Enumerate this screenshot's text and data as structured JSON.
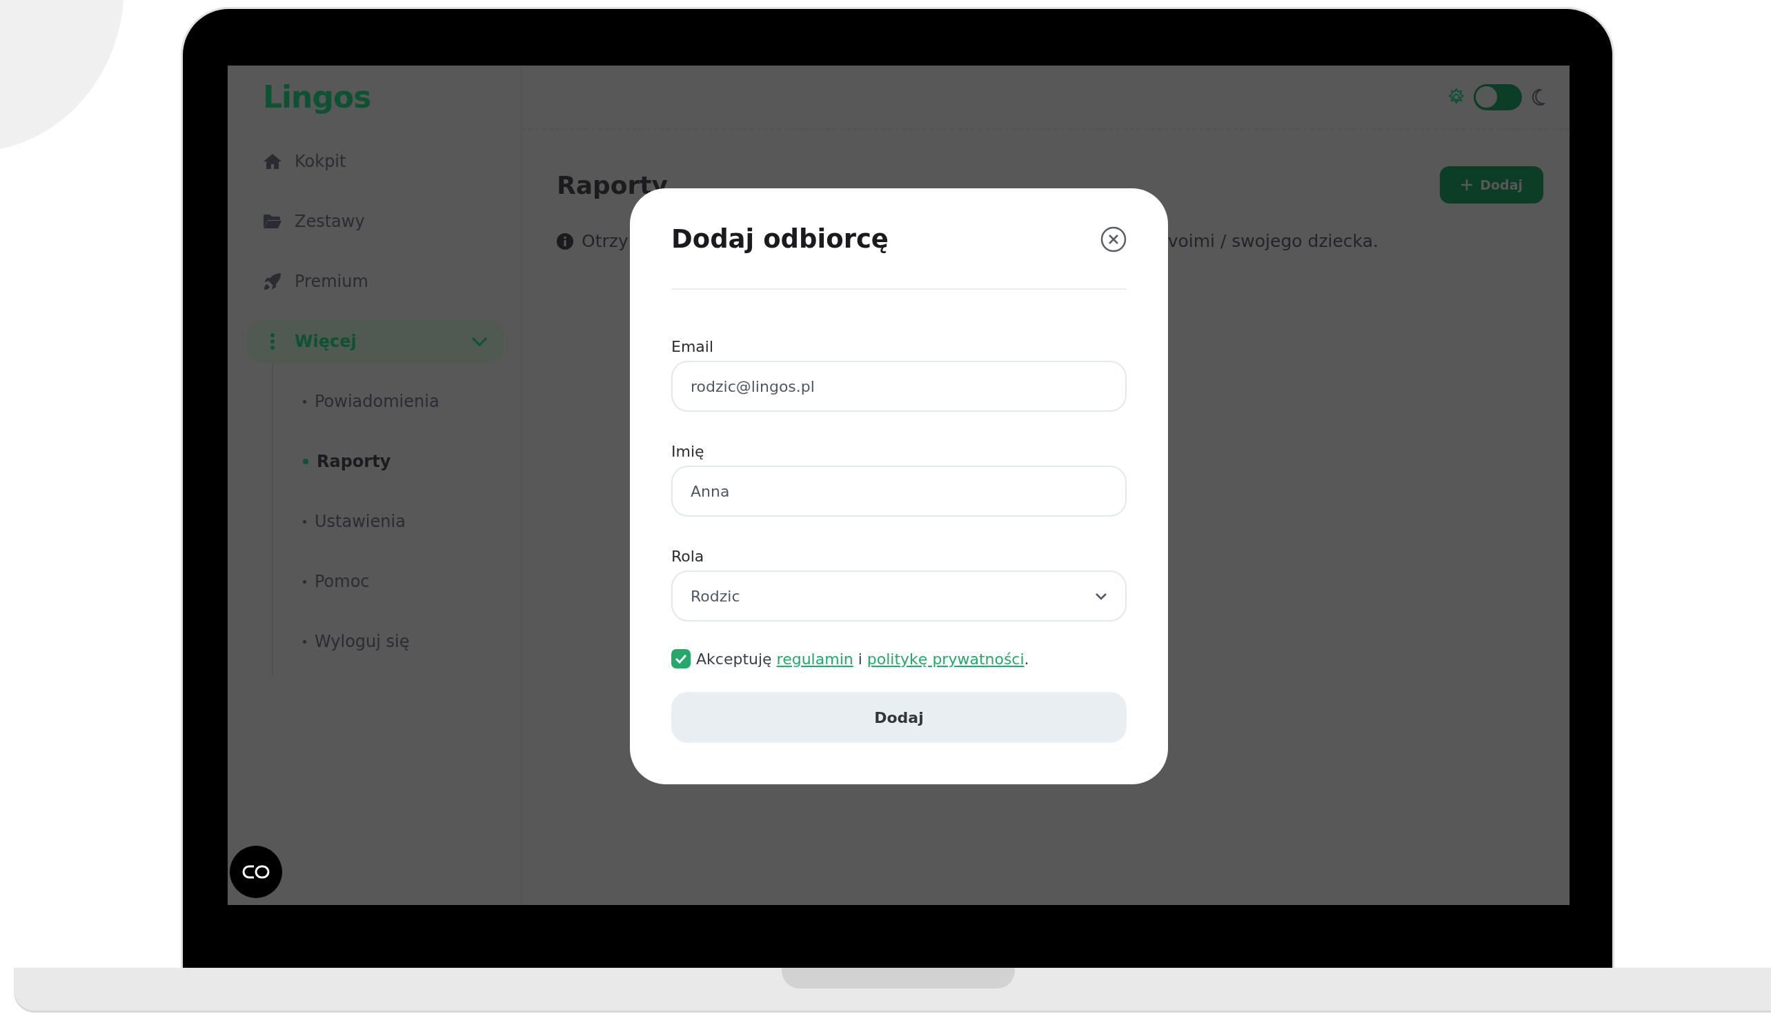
{
  "sidebar": {
    "logo": "Lingos",
    "items": [
      {
        "label": "Kokpit",
        "selected": false
      },
      {
        "label": "Zestawy",
        "selected": false
      },
      {
        "label": "Premium",
        "selected": false
      },
      {
        "label": "Więcej",
        "selected": true,
        "expanded": true,
        "children": [
          {
            "label": "Powiadomienia",
            "selected": false
          },
          {
            "label": "Raporty",
            "selected": true
          },
          {
            "label": "Ustawienia",
            "selected": false
          },
          {
            "label": "Pomoc",
            "selected": false
          },
          {
            "label": "Wyloguj się",
            "selected": false
          }
        ]
      }
    ]
  },
  "header": {
    "theme_toggle": {
      "on": false
    }
  },
  "main": {
    "title": "Raporty",
    "add_button": "Dodaj",
    "info_visible_parts": [
      "Otrzy",
      "voimi / swojego dziecka."
    ]
  },
  "modal": {
    "title": "Dodaj odbiorcę",
    "fields": [
      {
        "kind": "text",
        "label": "Email",
        "value": "rodzic@lingos.pl"
      },
      {
        "kind": "text",
        "label": "Imię",
        "value": "Anna"
      },
      {
        "kind": "select",
        "label": "Rola",
        "value": "Rodzic"
      }
    ],
    "consent": {
      "checked": true,
      "parts": [
        {
          "kind": "plain",
          "text": "Akceptuję "
        },
        {
          "kind": "link",
          "text": "regulamin"
        },
        {
          "kind": "plain",
          "text": " i "
        },
        {
          "kind": "link",
          "text": "politykę prywatności"
        },
        {
          "kind": "plain",
          "text": "."
        }
      ]
    },
    "submit": "Dodaj"
  }
}
